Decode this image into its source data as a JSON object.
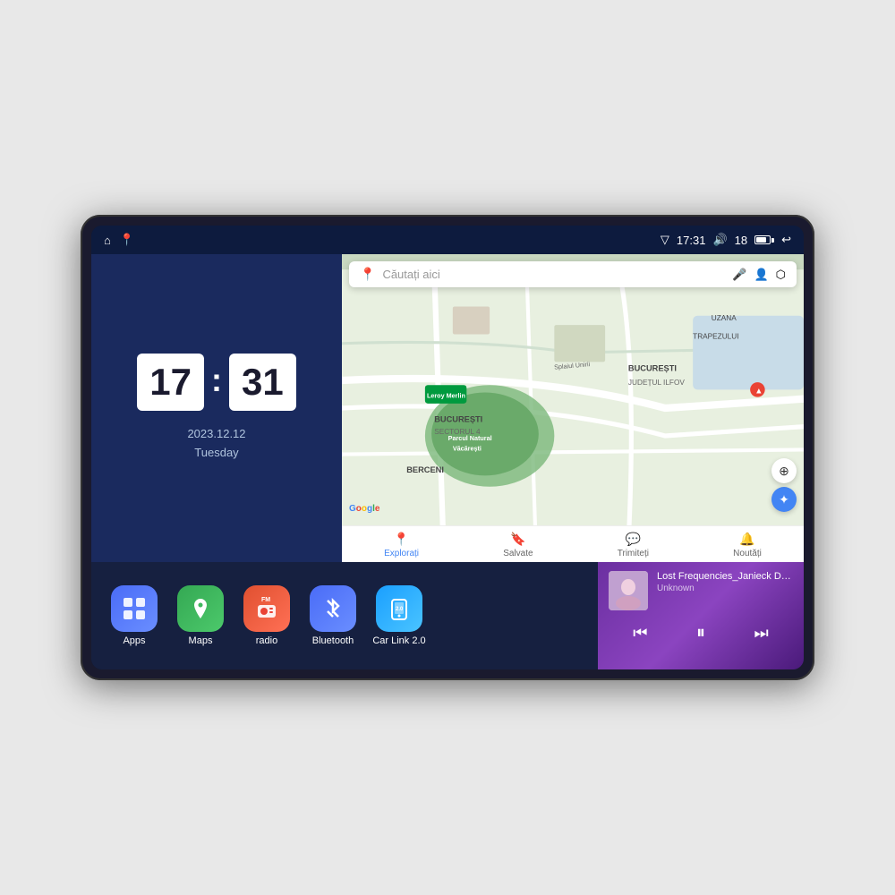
{
  "device": {
    "screen_bg": "#0d1b3e"
  },
  "status_bar": {
    "left_icons": [
      "home",
      "maps"
    ],
    "time": "17:31",
    "signal_icon": "▽",
    "volume_icon": "🔊",
    "battery_level": "18",
    "back_icon": "↩"
  },
  "clock": {
    "hours": "17",
    "minutes": "31",
    "date": "2023.12.12",
    "day": "Tuesday"
  },
  "map": {
    "search_placeholder": "Căutați aici",
    "locations": [
      "Parcul Natural Văcărești",
      "Leroy Merlin",
      "BUCUREȘTI SECTORUL 4",
      "BERCENI",
      "BUCUREȘTI",
      "JUDEȚUL ILFOV",
      "TRAPEZULUI",
      "UZANA"
    ],
    "nav_items": [
      {
        "label": "Explorați",
        "active": true,
        "icon": "📍"
      },
      {
        "label": "Salvate",
        "active": false,
        "icon": "🔖"
      },
      {
        "label": "Trimiteți",
        "active": false,
        "icon": "💬"
      },
      {
        "label": "Noutăți",
        "active": false,
        "icon": "🔔"
      }
    ]
  },
  "apps": [
    {
      "id": "apps",
      "label": "Apps",
      "icon": "⊞",
      "color_class": "icon-apps"
    },
    {
      "id": "maps",
      "label": "Maps",
      "icon": "📍",
      "color_class": "icon-maps"
    },
    {
      "id": "radio",
      "label": "radio",
      "icon": "📻",
      "color_class": "icon-radio"
    },
    {
      "id": "bluetooth",
      "label": "Bluetooth",
      "icon": "🔷",
      "color_class": "icon-bt"
    },
    {
      "id": "carlink",
      "label": "Car Link 2.0",
      "icon": "📱",
      "color_class": "icon-carlink"
    }
  ],
  "music": {
    "title": "Lost Frequencies_Janieck Devy-...",
    "artist": "Unknown",
    "prev_label": "⏮",
    "play_label": "⏸",
    "next_label": "⏭"
  }
}
